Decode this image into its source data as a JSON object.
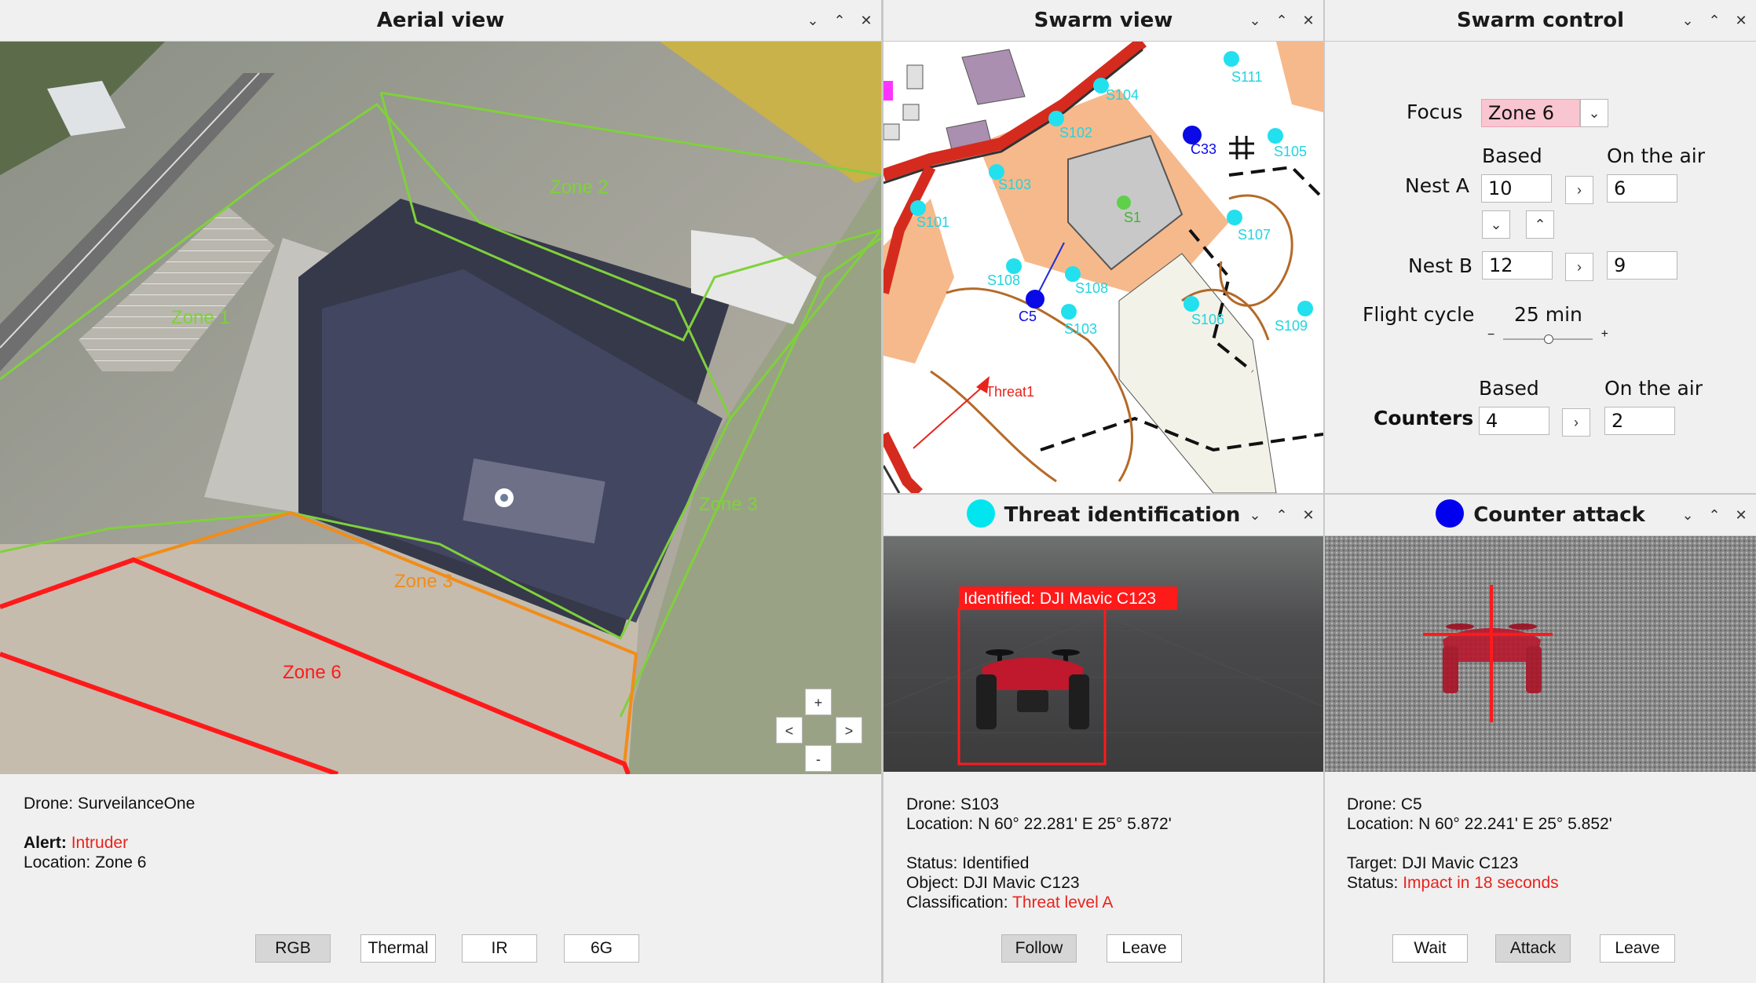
{
  "aerial": {
    "title": "Aerial view",
    "zones": {
      "zone2": "Zone 2",
      "zone1": "Zone 1",
      "zone3a": "Zone 3",
      "zone3b": "Zone 3",
      "zone6": "Zone 6"
    },
    "nav": {
      "left": "<",
      "right": ">",
      "zoom_in": "+",
      "zoom_out": "-"
    },
    "info": {
      "drone": "Drone: SurveilanceOne",
      "alert_label": "Alert:",
      "alert_value": "Intruder",
      "location": "Location: Zone 6"
    },
    "buttons": {
      "rgb": "RGB",
      "thermal": "Thermal",
      "ir": "IR",
      "g6": "6G"
    }
  },
  "swarm_view": {
    "title": "Swarm view",
    "drones": {
      "s111": "S111",
      "s104": "S104",
      "c33": "C33",
      "s105": "S105",
      "s102": "S102",
      "s103a": "S103",
      "s1": "S1",
      "s101": "S101",
      "s107": "S107",
      "s108": "S108",
      "s108b": "S108",
      "c5": "C5",
      "s103b": "S103",
      "s106": "S106",
      "s109": "S109"
    },
    "threat": "Threat1"
  },
  "swarm_control": {
    "title": "Swarm control",
    "focus_label": "Focus",
    "focus_value": "Zone 6",
    "col_based": "Based",
    "col_air": "On the air",
    "nest_a": {
      "label": "Nest A",
      "based": "10",
      "air": "6"
    },
    "nest_b": {
      "label": "Nest B",
      "based": "12",
      "air": "9"
    },
    "flight_cycle_label": "Flight cycle",
    "flight_cycle_value": "25 min",
    "slider_minus": "−",
    "slider_plus": "+",
    "flight_cycle_slider_fraction": 0.5,
    "counters": {
      "col_based": "Based",
      "col_air": "On the air",
      "label": "Counters",
      "based": "4",
      "air": "2"
    }
  },
  "threat_id": {
    "title": "Threat identification",
    "dot_color": "#00e5ee",
    "detection_label": "Identified: DJI Mavic C123",
    "info": {
      "drone": "Drone: S103",
      "location": "Location: N 60° 22.281' E 25° 5.872'",
      "status": "Status: Identified",
      "object": "Object: DJI Mavic C123",
      "class_label": "Classification:",
      "class_value": "Threat level A"
    },
    "buttons": {
      "follow": "Follow",
      "leave": "Leave"
    }
  },
  "counter": {
    "title": "Counter attack",
    "dot_color": "#0000ee",
    "info": {
      "drone": "Drone: C5",
      "location": "Location: N 60° 22.241' E 25° 5.852'",
      "target": "Target: DJI Mavic C123",
      "status_label": "Status:",
      "status_value": "Impact in 18 seconds"
    },
    "buttons": {
      "wait": "Wait",
      "attack": "Attack",
      "leave": "Leave"
    }
  },
  "window_controls": {
    "minimize": "⌄",
    "maximize": "⌃",
    "close": "✕"
  },
  "colors": {
    "alert_red": "#e8231c",
    "zone_green": "#7fd13b",
    "zone_orange": "#f28c18",
    "zone_red": "#ff1a1a",
    "drone_cyan": "#22e0ee"
  }
}
